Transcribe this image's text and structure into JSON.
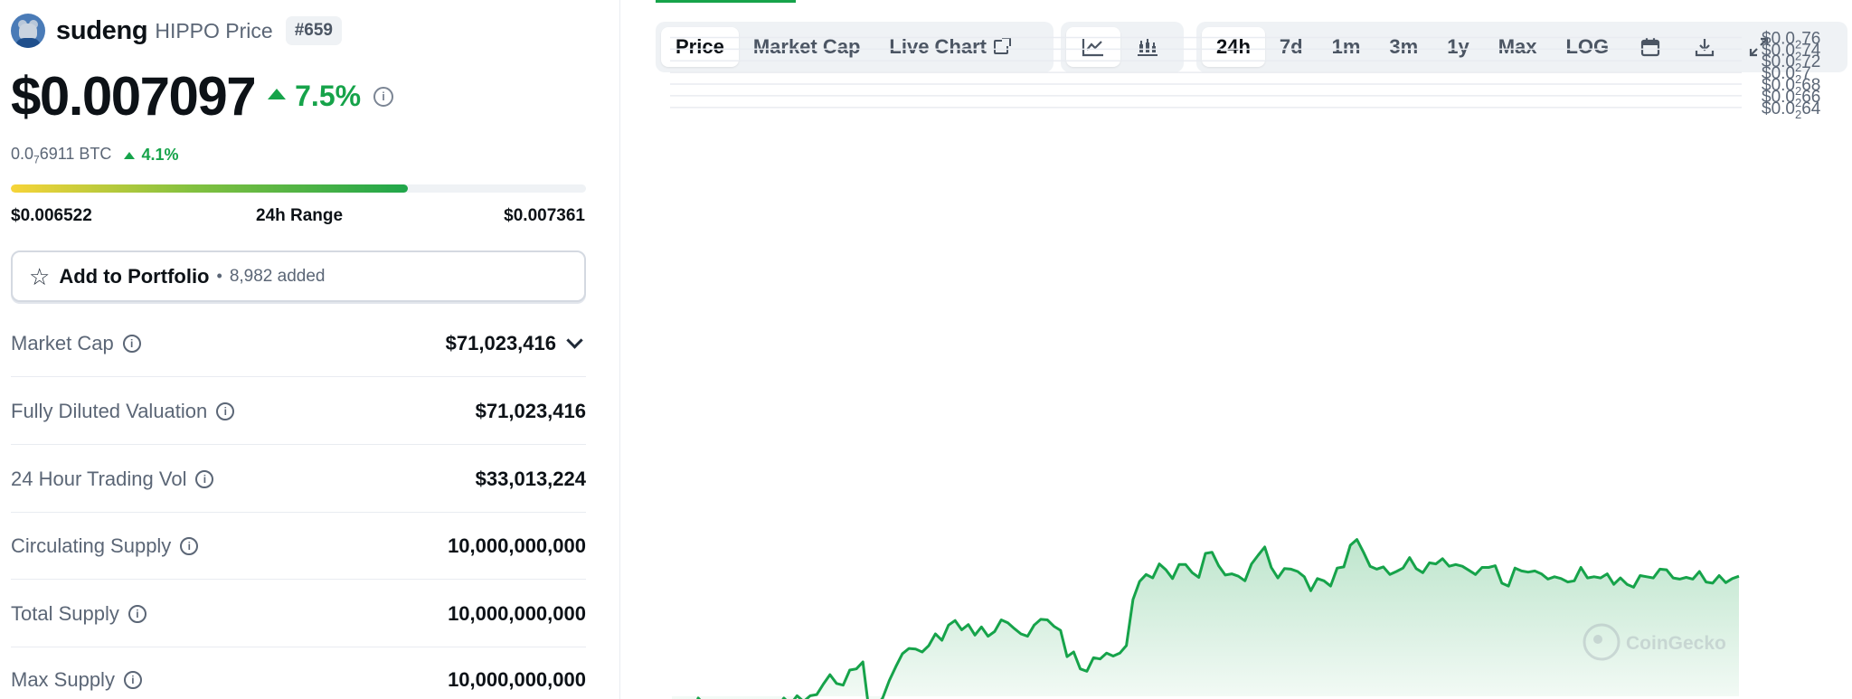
{
  "coin": {
    "name": "sudeng",
    "ticker_label": "HIPPO Price",
    "rank": "#659",
    "price": "$0.007097",
    "change_24h": "7.5%",
    "btc_price_prefix": "0.0",
    "btc_price_sub": "7",
    "btc_price_suffix": "6911 BTC",
    "btc_change": "4.1%",
    "range_low": "$0.006522",
    "range_label": "24h Range",
    "range_high": "$0.007361",
    "range_position": 0.69,
    "up_color": "#16a34a"
  },
  "portfolio": {
    "label": "Add to Portfolio",
    "separator": "•",
    "count": "8,982 added"
  },
  "stats": [
    {
      "label": "Market Cap",
      "value": "$71,023,416"
    },
    {
      "label": "Fully Diluted Valuation",
      "value": "$71,023,416"
    },
    {
      "label": "24 Hour Trading Vol",
      "value": "$33,013,224"
    },
    {
      "label": "Circulating Supply",
      "value": "10,000,000,000"
    },
    {
      "label": "Total Supply",
      "value": "10,000,000,000"
    },
    {
      "label": "Max Supply",
      "value": "10,000,000,000"
    }
  ],
  "chart_tabs": {
    "views": [
      "Price",
      "Market Cap",
      "Live Chart"
    ],
    "active_view": "Price",
    "chart_types": [
      "line-chart-icon",
      "candlestick-icon"
    ],
    "active_type": "line-chart-icon",
    "ranges": [
      "24h",
      "7d",
      "1m",
      "3m",
      "1y",
      "Max",
      "LOG"
    ],
    "active_range": "24h",
    "tools": [
      "calendar-icon",
      "download-icon",
      "fullscreen-icon"
    ]
  },
  "watermark": "CoinGecko",
  "chart_data": {
    "type": "area",
    "grid": true,
    "ylim": [
      0.00663,
      0.00777
    ],
    "y_ticks": [
      {
        "pre": "$0.0",
        "sub": "2",
        "post": "76",
        "value": 0.00776
      },
      {
        "pre": "$0.0",
        "sub": "2",
        "post": "74",
        "value": 0.00774
      },
      {
        "pre": "$0.0",
        "sub": "2",
        "post": "72",
        "value": 0.00772
      },
      {
        "pre": "$0.0",
        "sub": "2",
        "post": "7",
        "value": 0.0077
      },
      {
        "pre": "$0.0",
        "sub": "2",
        "post": "68",
        "value": 0.00768
      },
      {
        "pre": "$0.0",
        "sub": "2",
        "post": "66",
        "value": 0.00766
      },
      {
        "pre": "$0.0",
        "sub": "2",
        "post": "64",
        "value": 0.00764
      }
    ],
    "series": [
      {
        "values": [
          0.006603,
          0.006594,
          0.006601,
          0.006596,
          0.006627,
          0.006615,
          0.006597,
          0.006592,
          0.006603,
          0.006586,
          0.006601,
          0.006604,
          0.006592,
          0.006612,
          0.006618,
          0.006611,
          0.006609,
          0.006627,
          0.006616,
          0.006631,
          0.006621,
          0.006631,
          0.006633,
          0.006651,
          0.006667,
          0.006652,
          0.006649,
          0.006675,
          0.006677,
          0.006689,
          0.006599,
          0.006612,
          0.006627,
          0.006657,
          0.006681,
          0.006703,
          0.006712,
          0.006711,
          0.006706,
          0.006717,
          0.006737,
          0.006726,
          0.006752,
          0.00676,
          0.006744,
          0.006753,
          0.006735,
          0.006749,
          0.006733,
          0.006741,
          0.006761,
          0.006756,
          0.006746,
          0.006737,
          0.006733,
          0.006752,
          0.006762,
          0.006761,
          0.00675,
          0.006743,
          0.006698,
          0.006706,
          0.006677,
          0.006673,
          0.006696,
          0.006694,
          0.006704,
          0.006699,
          0.006704,
          0.006717,
          0.006796,
          0.006827,
          0.006839,
          0.006833,
          0.006857,
          0.006847,
          0.006832,
          0.006856,
          0.006856,
          0.006842,
          0.006834,
          0.006875,
          0.006877,
          0.006854,
          0.006838,
          0.00684,
          0.006836,
          0.006828,
          0.006857,
          0.006872,
          0.006886,
          0.006851,
          0.006833,
          0.006849,
          0.006848,
          0.006844,
          0.006835,
          0.006811,
          0.006832,
          0.006828,
          0.006819,
          0.00685,
          0.006852,
          0.006889,
          0.006899,
          0.006877,
          0.006853,
          0.006848,
          0.006852,
          0.006839,
          0.006844,
          0.00685,
          0.006868,
          0.006849,
          0.006842,
          0.006859,
          0.006857,
          0.006866,
          0.006853,
          0.006856,
          0.006853,
          0.006846,
          0.006839,
          0.006851,
          0.006851,
          0.006854,
          0.006824,
          0.006819,
          0.00685,
          0.006845,
          0.006843,
          0.006845,
          0.00684,
          0.006831,
          0.006835,
          0.006832,
          0.006826,
          0.006828,
          0.006851,
          0.006833,
          0.006835,
          0.006833,
          0.00684,
          0.006822,
          0.006833,
          0.006822,
          0.006817,
          0.006837,
          0.006835,
          0.006833,
          0.006848,
          0.006847,
          0.006833,
          0.006831,
          0.006834,
          0.006831,
          0.006844,
          0.006826,
          0.006824,
          0.006837,
          0.006825,
          0.006832,
          0.006836
        ],
        "line_color": "#16a34a"
      }
    ]
  }
}
